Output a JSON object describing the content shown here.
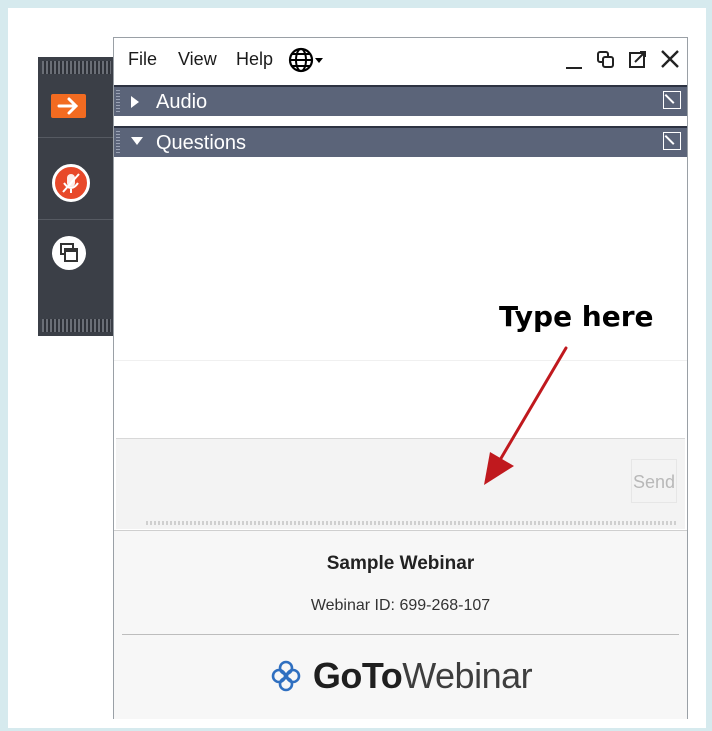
{
  "menu": {
    "file": "File",
    "view": "View",
    "help": "Help"
  },
  "sections": {
    "audio": {
      "label": "Audio"
    },
    "questions": {
      "label": "Questions"
    }
  },
  "input": {
    "send_label": "Send",
    "placeholder": ""
  },
  "webinar": {
    "name": "Sample Webinar",
    "id_text": "Webinar ID: 699-268-107"
  },
  "brand": {
    "goto": "GoTo",
    "webinar": "Webinar"
  },
  "annotation": {
    "text": "Type here"
  },
  "colors": {
    "accent_orange": "#f26b21",
    "mic_red": "#e8492a",
    "section_header": "#5b6479",
    "annotation_arrow": "#c0191e",
    "brand_blue": "#2f6fc0"
  },
  "icons": {
    "strip": [
      "arrow-right-icon",
      "mic-muted-icon",
      "screen-share-icon"
    ],
    "menu": [
      "globe-icon",
      "chevron-down-icon"
    ],
    "window": [
      "minimize-icon",
      "restore-icon",
      "popout-icon",
      "close-icon"
    ]
  }
}
